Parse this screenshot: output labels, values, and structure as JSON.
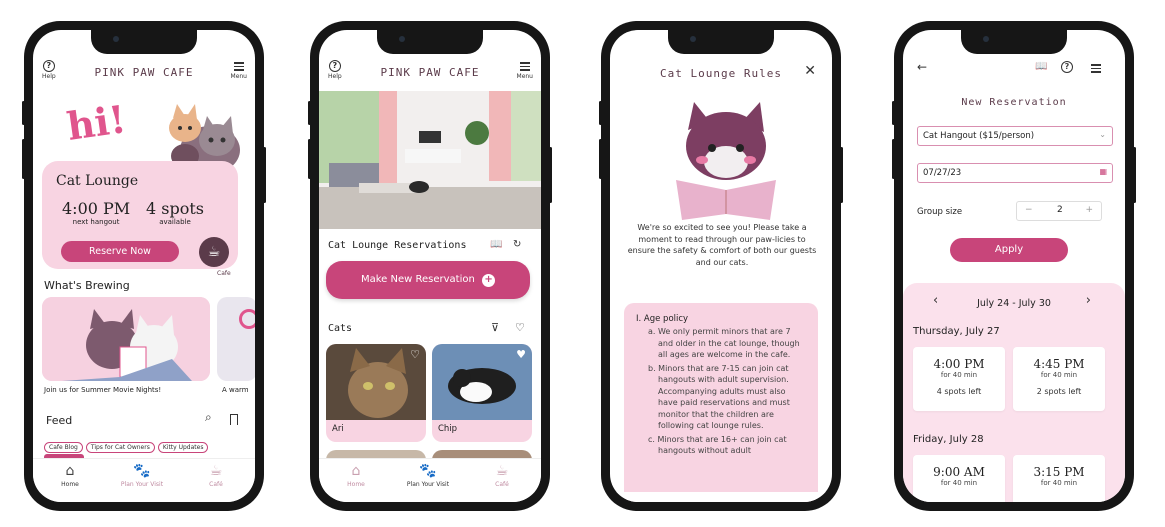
{
  "colors": {
    "accent": "#c8457a",
    "pink_light": "#f8d4e2",
    "pink_bg": "#fbe1ec"
  },
  "screen1": {
    "help": "Help",
    "menu": "Menu",
    "title": "PINK PAW CAFE",
    "hi": "hi!",
    "lounge": {
      "title": "Cat Lounge",
      "time": "4:00 PM",
      "time_label": "next hangout",
      "spots": "4 spots",
      "spots_label": "available",
      "button": "Reserve Now",
      "cafe_label": "Cafe"
    },
    "brewing": {
      "heading": "What's Brewing",
      "card1_caption": "Join us for Summer Movie Nights!",
      "card2_caption": "A warm"
    },
    "feed": {
      "heading": "Feed",
      "chips": [
        "Cafe Blog",
        "Tips for Cat Owners",
        "Kitty Updates"
      ]
    },
    "tabs": [
      "Home",
      "Plan Your Visit",
      "Café"
    ]
  },
  "screen2": {
    "help": "Help",
    "menu": "Menu",
    "title": "PINK PAW CAFE",
    "reservations_heading": "Cat Lounge Reservations",
    "new_button": "Make New Reservation",
    "cats_heading": "Cats",
    "cats": [
      "Ari",
      "Chip"
    ],
    "tabs": [
      "Home",
      "Plan Your Visit",
      "Café"
    ]
  },
  "screen3": {
    "title": "Cat Lounge Rules",
    "intro": "We're so excited to see you!  Please take a moment to read through our paw-licies to ensure the safety & comfort of both our guests and our cats.",
    "policy_heading": "I. Age policy",
    "items": [
      "a. We only permit minors that are 7 and older in the cat lounge, though all ages are welcome in the cafe.",
      "b. Minors that are 7-15 can join cat hangouts with adult supervision. Accompanying adults must also have paid reservations and must monitor that the children are following cat lounge rules.",
      "c. Minors that are 16+ can join cat hangouts without adult"
    ]
  },
  "screen4": {
    "title": "New Reservation",
    "select": "Cat Hangout ($15/person)",
    "date": "07/27/23",
    "group_label": "Group size",
    "group_value": "2",
    "minus": "−",
    "plus": "+",
    "apply": "Apply",
    "week": "July 24 - July 30",
    "days": [
      {
        "label": "Thursday, July 27",
        "slots": [
          {
            "time": "4:00 PM",
            "dur": "for 40 min",
            "spots": "4 spots left"
          },
          {
            "time": "4:45 PM",
            "dur": "for 40 min",
            "spots": "2 spots left"
          }
        ]
      },
      {
        "label": "Friday, July 28",
        "slots": [
          {
            "time": "9:00 AM",
            "dur": "for 40 min"
          },
          {
            "time": "3:15 PM",
            "dur": "for 40 min"
          }
        ]
      }
    ]
  }
}
